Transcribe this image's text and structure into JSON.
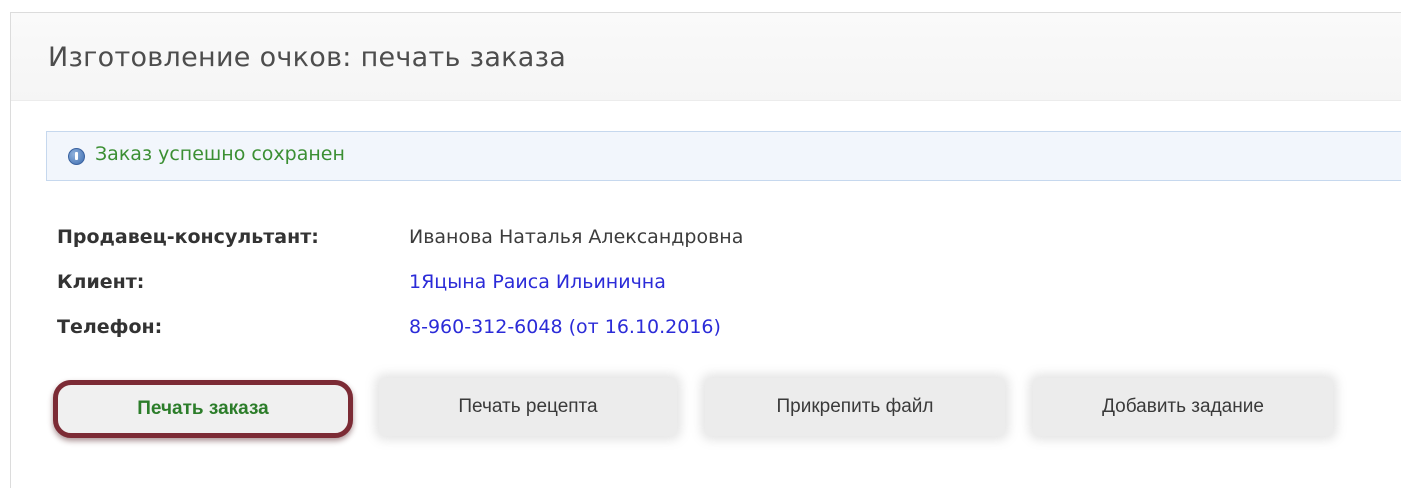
{
  "page": {
    "title": "Изготовление очков: печать заказа"
  },
  "alert": {
    "icon": "info-icon",
    "message": "Заказ успешно сохранен",
    "text_color": "#3b8f33"
  },
  "order_info": {
    "seller": {
      "label": "Продавец-консультант:",
      "value": "Иванова Наталья Александровна"
    },
    "client": {
      "label": "Клиент:",
      "value": "1Яцына Раиса Ильинична"
    },
    "phone": {
      "label": "Телефон:",
      "value": "8-960-312-6048 (от 16.10.2016)"
    }
  },
  "actions": {
    "print_order": "Печать заказа",
    "print_prescription": "Печать рецепта",
    "attach_file": "Прикрепить файл",
    "add_task": "Добавить задание"
  },
  "colors": {
    "link": "#2b2bd8",
    "highlight_border": "#7c2b35",
    "primary_text": "#2c7d2a"
  }
}
